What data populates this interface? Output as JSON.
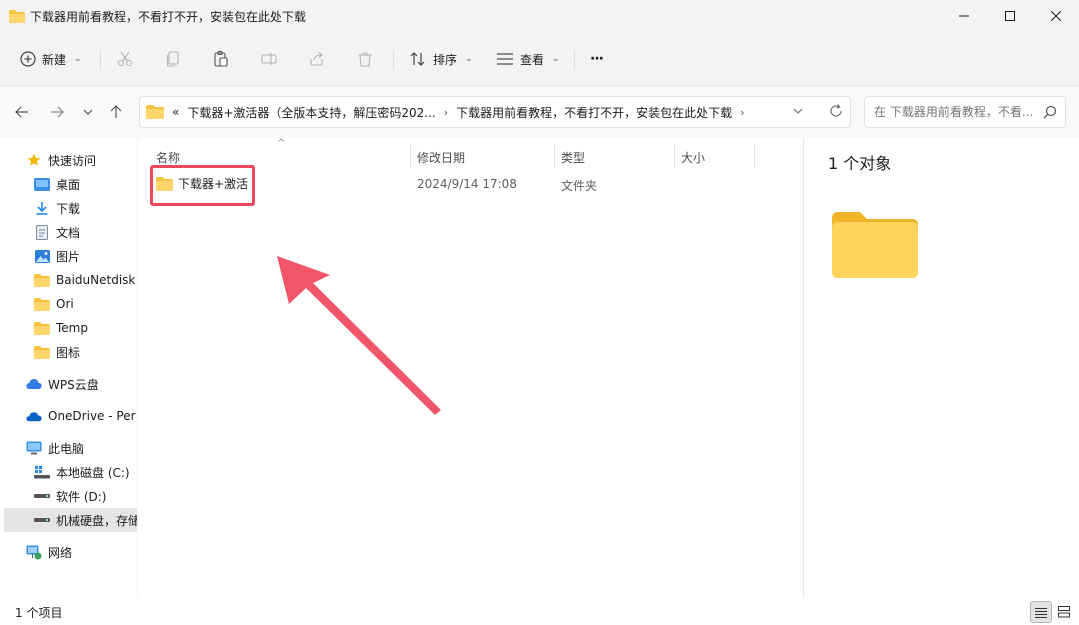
{
  "window": {
    "title": "下载器用前看教程，不看打不开，安装包在此处下载"
  },
  "toolbar": {
    "new_label": "新建",
    "sort_label": "排序",
    "view_label": "查看",
    "more_label": "···"
  },
  "address": {
    "overflow": "«",
    "crumbs": [
      "下载器+激活器（全版本支持，解压密码202...",
      "下载器用前看教程，不看打不开，安装包在此处下载"
    ]
  },
  "search": {
    "placeholder": "在 下载器用前看教程，不看..."
  },
  "sidebar": {
    "items": [
      {
        "label": "快速访问",
        "icon": "star-icon"
      },
      {
        "label": "桌面",
        "icon": "desktop-icon",
        "pinned": true
      },
      {
        "label": "下载",
        "icon": "download-icon",
        "pinned": true
      },
      {
        "label": "文档",
        "icon": "document-icon",
        "pinned": true
      },
      {
        "label": "图片",
        "icon": "picture-icon",
        "pinned": true
      },
      {
        "label": "BaiduNetdisk",
        "icon": "folder-icon"
      },
      {
        "label": "Ori",
        "icon": "folder-icon"
      },
      {
        "label": "Temp",
        "icon": "folder-icon"
      },
      {
        "label": "图标",
        "icon": "folder-icon"
      },
      {
        "label": "WPS云盘",
        "icon": "cloud-icon"
      },
      {
        "label": "OneDrive - Per",
        "icon": "onedrive-icon"
      },
      {
        "label": "此电脑",
        "icon": "computer-icon"
      },
      {
        "label": "本地磁盘 (C:)",
        "icon": "drive-c-icon"
      },
      {
        "label": "软件 (D:)",
        "icon": "drive-icon"
      },
      {
        "label": "机械硬盘，存储",
        "icon": "drive-icon",
        "selected": true
      },
      {
        "label": "网络",
        "icon": "network-icon"
      }
    ]
  },
  "list": {
    "columns": [
      "名称",
      "修改日期",
      "类型",
      "大小"
    ],
    "rows": [
      {
        "name": "下载器+激活",
        "date": "2024/9/14 17:08",
        "type": "文件夹",
        "size": ""
      }
    ]
  },
  "details": {
    "count": "1 个对象"
  },
  "status": {
    "text": "1 个项目"
  },
  "colors": {
    "folder": "#f5c542",
    "accent_arrow": "#f0556a",
    "highlight": "#e8475c"
  }
}
